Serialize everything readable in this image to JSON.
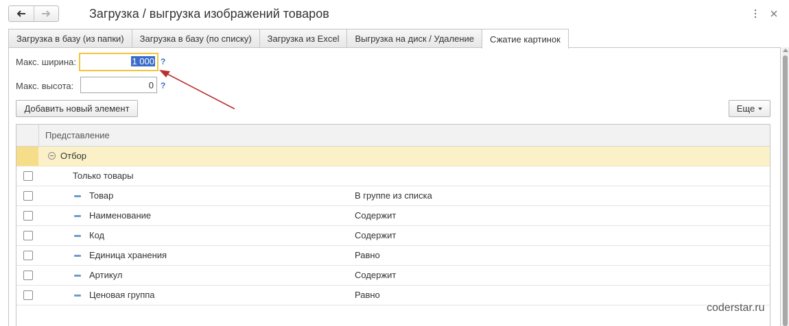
{
  "window": {
    "title": "Загрузка / выгрузка изображений товаров"
  },
  "tabs": [
    {
      "label": "Загрузка в базу (из папки)"
    },
    {
      "label": "Загрузка в базу (по списку)"
    },
    {
      "label": "Загрузка из Excel"
    },
    {
      "label": "Выгрузка на диск / Удаление"
    },
    {
      "label": "Сжатие картинок",
      "active": true
    }
  ],
  "form": {
    "max_width_label": "Макс. ширина:",
    "max_width_value": "1 000",
    "max_height_label": "Макс. высота:",
    "max_height_value": "0",
    "help_glyph": "?"
  },
  "toolbar": {
    "add_label": "Добавить новый элемент",
    "more_label": "Еще"
  },
  "grid": {
    "column_header": "Представление",
    "group_label": "Отбор",
    "rows": [
      {
        "label": "Только товары",
        "value": ""
      },
      {
        "label": "Товар",
        "value": "В группе из списка"
      },
      {
        "label": "Наименование",
        "value": "Содержит"
      },
      {
        "label": "Код",
        "value": "Содержит"
      },
      {
        "label": "Единица хранения",
        "value": "Равно"
      },
      {
        "label": "Артикул",
        "value": "Содержит"
      },
      {
        "label": "Ценовая группа",
        "value": "Равно"
      }
    ]
  },
  "watermark": "coderstar.ru",
  "colors": {
    "focus": "#f5c33b",
    "selection": "#3a6dc9",
    "group_row": "#fbf1c9",
    "arrow": "#b83030"
  }
}
